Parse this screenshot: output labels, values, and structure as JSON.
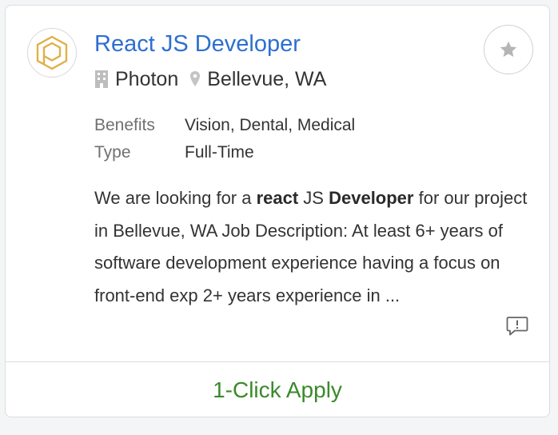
{
  "job": {
    "title": "React JS Developer",
    "company": "Photon",
    "location": "Bellevue, WA"
  },
  "details": [
    {
      "label": "Benefits",
      "value": "Vision, Dental, Medical"
    },
    {
      "label": "Type",
      "value": "Full-Time"
    }
  ],
  "description": {
    "p1": "We are looking for a ",
    "b1": "react",
    "p2": " JS ",
    "b2": "Developer",
    "p3": " for our project in Bellevue, WA Job Description: At least 6+ years of software development experience having a focus on front-end exp 2+ years experience in ..."
  },
  "actions": {
    "apply_label": "1-Click Apply"
  },
  "icons": {
    "logo": "photon-hexagon-logo",
    "company": "building-icon",
    "location": "map-pin-icon",
    "favorite": "star-icon",
    "report": "report-message-icon"
  },
  "colors": {
    "title_link": "#2d6fd1",
    "apply": "#3a8a2a",
    "logo": "#e0b04a"
  }
}
